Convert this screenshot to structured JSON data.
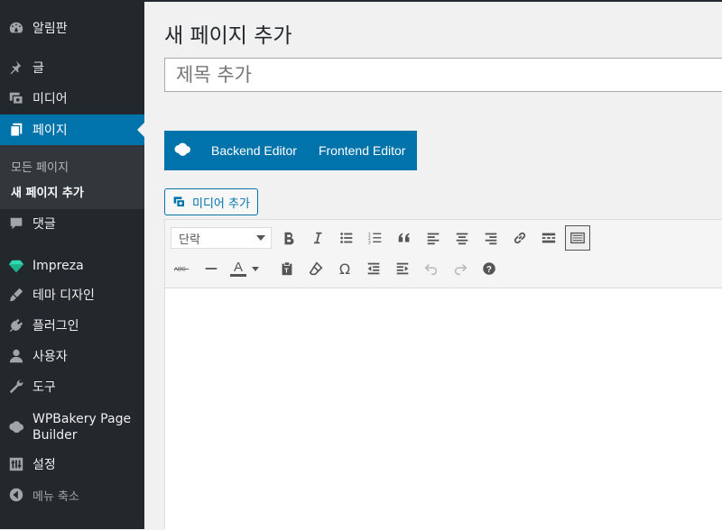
{
  "sidebar": {
    "items": [
      {
        "label": "알림판",
        "icon": "dashboard-icon"
      },
      {
        "label": "글",
        "icon": "pin-icon"
      },
      {
        "label": "미디어",
        "icon": "media-icon"
      },
      {
        "label": "페이지",
        "icon": "pages-icon"
      },
      {
        "label": "댓글",
        "icon": "comment-icon"
      },
      {
        "label": "Impreza",
        "icon": "diamond-icon"
      },
      {
        "label": "테마 디자인",
        "icon": "brush-icon"
      },
      {
        "label": "플러그인",
        "icon": "plugin-icon"
      },
      {
        "label": "사용자",
        "icon": "user-icon"
      },
      {
        "label": "도구",
        "icon": "wrench-icon"
      },
      {
        "label": "WPBakery Page Builder",
        "icon": "wpbakery-icon"
      },
      {
        "label": "설정",
        "icon": "settings-icon"
      },
      {
        "label": "메뉴 축소",
        "icon": "collapse-icon"
      }
    ],
    "submenu": [
      "모든 페이지",
      "새 페이지 추가"
    ]
  },
  "main": {
    "page_title": "새 페이지 추가",
    "title_placeholder": "제목 추가",
    "wpbakery": {
      "backend": "Backend Editor",
      "frontend": "Frontend Editor"
    },
    "add_media": "미디어 추가",
    "format_select": "단락",
    "text_color_letter": "A",
    "omega": "Ω"
  },
  "colors": {
    "sidebar": "#23282d",
    "accent": "#0073aa",
    "submenu": "#32373c"
  }
}
